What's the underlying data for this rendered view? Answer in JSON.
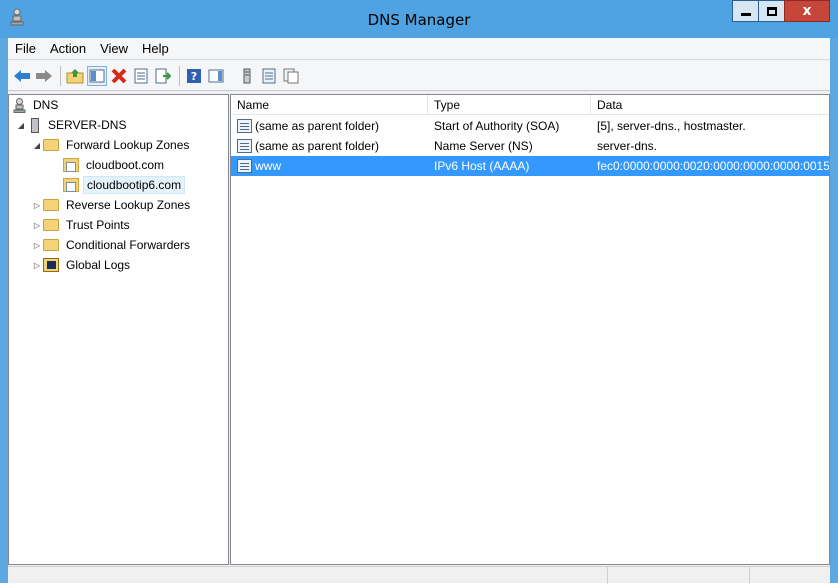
{
  "window": {
    "title": "DNS Manager",
    "close_glyph": "x",
    "minimize_glyph": "–",
    "maximize_glyph": "□"
  },
  "menu": [
    {
      "label": "File"
    },
    {
      "label": "Action"
    },
    {
      "label": "View"
    },
    {
      "label": "Help"
    }
  ],
  "toolbar": {
    "icons": [
      "back-arrow-icon",
      "forward-arrow-icon",
      "up-folder-icon",
      "show-hide-tree-icon",
      "delete-icon",
      "properties-icon",
      "export-list-icon",
      "help-icon",
      "show-hide-action-pane-icon",
      "server-icon",
      "record-icon",
      "copy-icon"
    ]
  },
  "tree": {
    "root": "DNS",
    "server": "SERVER-DNS",
    "forward_lookup_zones": "Forward Lookup Zones",
    "zone_1": "cloudboot.com",
    "zone_2": "cloudbootip6.com",
    "reverse_lookup_zones": "Reverse Lookup Zones",
    "trust_points": "Trust Points",
    "conditional_forwarders": "Conditional Forwarders",
    "global_logs": "Global Logs"
  },
  "list": {
    "columns": {
      "name": "Name",
      "type": "Type",
      "data": "Data"
    },
    "rows": [
      {
        "name": "(same as parent folder)",
        "type": "Start of Authority (SOA)",
        "data": "[5], server-dns., hostmaster."
      },
      {
        "name": "(same as parent folder)",
        "type": "Name Server (NS)",
        "data": "server-dns."
      },
      {
        "name": "www",
        "type": "IPv6 Host (AAAA)",
        "data": "fec0:0000:0000:0020:0000:0000:0000:0015"
      }
    ]
  },
  "colors": {
    "titlebar": "#4fa3e3",
    "selection": "#3399ff",
    "close_button": "#c7463a"
  }
}
